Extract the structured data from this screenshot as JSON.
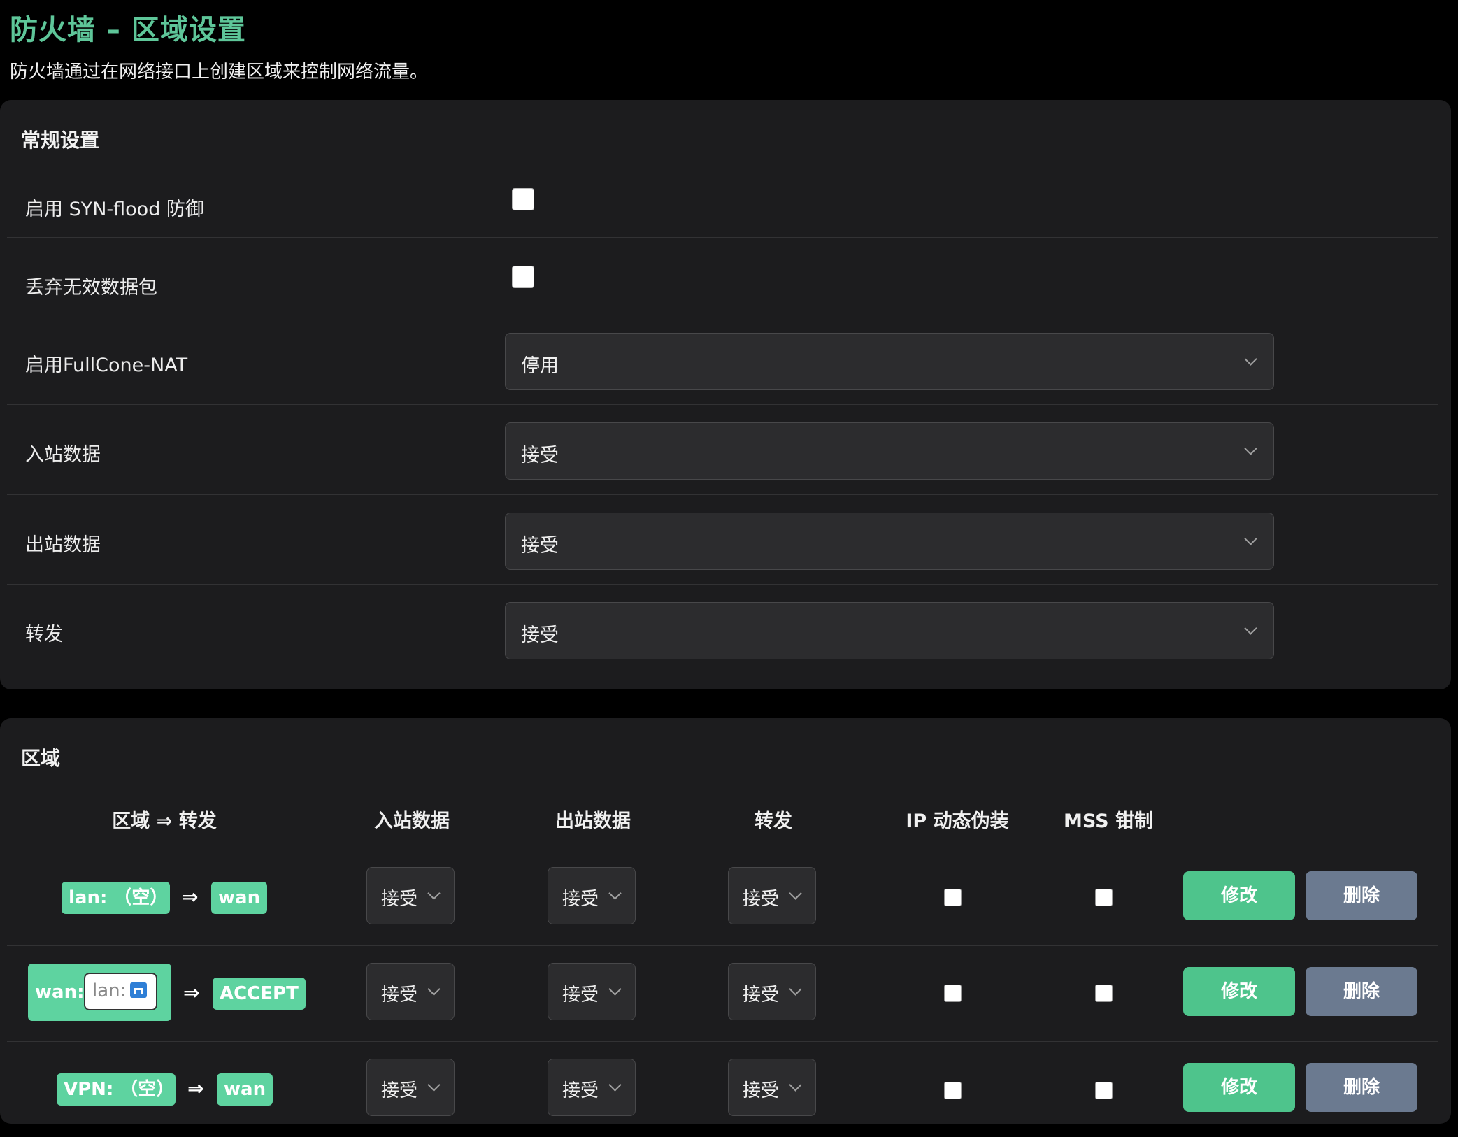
{
  "page": {
    "title": "防火墙 – 区域设置",
    "description": "防火墙通过在网络接口上创建区域来控制网络流量。"
  },
  "general": {
    "title": "常规设置",
    "syn_flood": {
      "label": "启用 SYN-flood 防御",
      "checked": false
    },
    "drop_invalid": {
      "label": "丢弃无效数据包",
      "checked": false
    },
    "fullcone": {
      "label": "启用FullCone-NAT",
      "value": "停用"
    },
    "input": {
      "label": "入站数据",
      "value": "接受"
    },
    "output": {
      "label": "出站数据",
      "value": "接受"
    },
    "forward": {
      "label": "转发",
      "value": "接受"
    }
  },
  "zones": {
    "title": "区域",
    "headers": {
      "zone_forward": "区域 ⇒ 转发",
      "input": "入站数据",
      "output": "出站数据",
      "forward": "转发",
      "masq": "IP 动态伪装",
      "mss": "MSS 钳制"
    },
    "arrow": "⇒",
    "rows": [
      {
        "zone": "lan: （空）",
        "dest": "wan",
        "input": "接受",
        "output": "接受",
        "forward": "接受",
        "masq": false,
        "mss": false,
        "edit": "修改",
        "delete": "删除"
      },
      {
        "zone": "wan:",
        "iface": "lan:",
        "dest": "ACCEPT",
        "input": "接受",
        "output": "接受",
        "forward": "接受",
        "masq": false,
        "mss": false,
        "edit": "修改",
        "delete": "删除"
      },
      {
        "zone": "VPN: （空）",
        "dest": "wan",
        "input": "接受",
        "output": "接受",
        "forward": "接受",
        "masq": false,
        "mss": false,
        "edit": "修改",
        "delete": "删除"
      }
    ]
  },
  "colors": {
    "accent": "#5ec699",
    "badge": "#5ed3a0",
    "edit_button": "#4ec48c",
    "delete_button": "#6b7a90"
  }
}
